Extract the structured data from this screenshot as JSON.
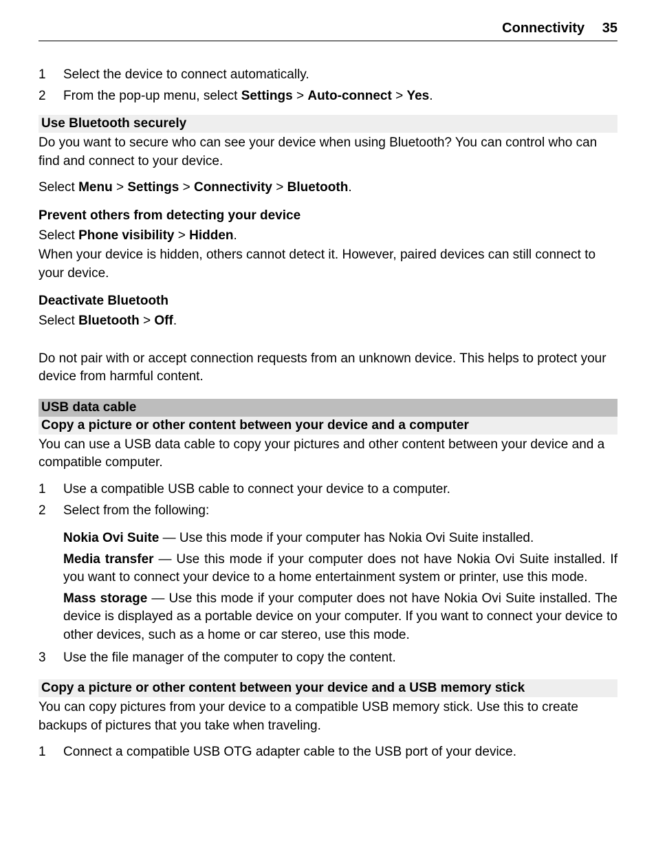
{
  "header": {
    "section": "Connectivity",
    "page": "35"
  },
  "list1": [
    {
      "n": "1",
      "text": "Select the device to connect automatically."
    },
    {
      "n": "2",
      "prefix": "From the pop-up menu, select ",
      "b1": "Settings",
      "s1": " > ",
      "b2": "Auto-connect",
      "s2": " > ",
      "b3": "Yes",
      "suffix": "."
    }
  ],
  "sec_bt_secure": {
    "title": "Use Bluetooth securely",
    "intro": "Do you want to secure who can see your device when using Bluetooth? You can control who can find and connect to your device.",
    "select_prefix": "Select ",
    "m1": "Menu",
    "s1": " > ",
    "m2": "Settings",
    "s2": " > ",
    "m3": "Connectivity",
    "s3": " > ",
    "m4": "Bluetooth",
    "dot": "."
  },
  "sec_prevent": {
    "title": "Prevent others from detecting your device",
    "select_prefix": "Select ",
    "b1": "Phone visibility",
    "s1": " > ",
    "b2": "Hidden",
    "dot": ".",
    "note": "When your device is hidden, others cannot detect it. However, paired devices can still connect to your device."
  },
  "sec_deactivate": {
    "title": "Deactivate Bluetooth",
    "select_prefix": "Select ",
    "b1": "Bluetooth",
    "s1": " > ",
    "b2": "Off",
    "dot": "."
  },
  "warn": "Do not pair with or accept connection requests from an unknown device. This helps to protect your device from harmful content.",
  "usb": {
    "heading": "USB data cable",
    "sub1": "Copy a picture or other content between your device and a computer",
    "intro1": "You can use a USB data cable to copy your pictures and other content between your device and a compatible computer.",
    "steps1": [
      {
        "n": "1",
        "text": "Use a compatible USB cable to connect your device to a computer."
      },
      {
        "n": "2",
        "text": "Select from the following:"
      }
    ],
    "modes": [
      {
        "name": "Nokia Ovi Suite",
        "desc": " — Use this mode if your computer has Nokia Ovi Suite installed."
      },
      {
        "name": "Media transfer",
        "desc": " — Use this mode if your computer does not have Nokia Ovi Suite installed. If you want to connect your device to a home entertainment system or printer, use this mode."
      },
      {
        "name": "Mass storage",
        "desc": " — Use this mode if your computer does not have Nokia Ovi Suite installed. The device is displayed as a portable device on your computer. If you want to connect your device to other devices, such as a home or car stereo, use this mode."
      }
    ],
    "step3": {
      "n": "3",
      "text": "Use the file manager of the computer to copy the content."
    },
    "sub2": "Copy a picture or other content between your device and a USB memory stick",
    "intro2": "You can copy pictures from your device to a compatible USB memory stick. Use this to create backups of pictures that you take when traveling.",
    "steps2": [
      {
        "n": "1",
        "text": "Connect a compatible USB OTG adapter cable to the USB port of your device."
      }
    ]
  }
}
